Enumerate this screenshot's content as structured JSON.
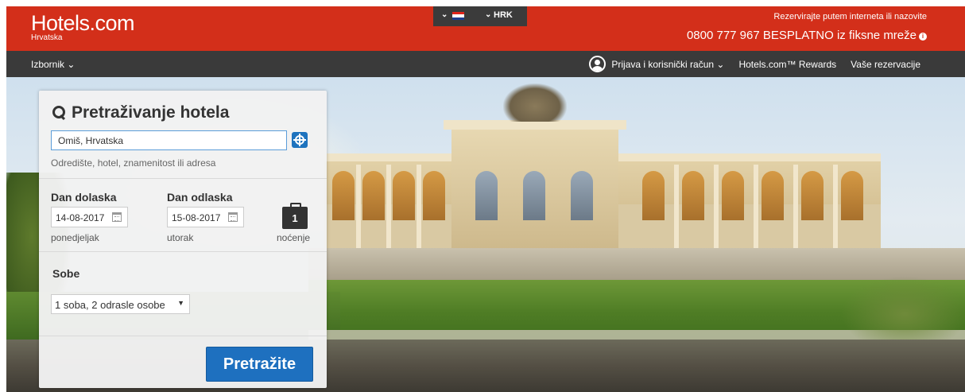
{
  "header": {
    "logo": "Hotels.com",
    "logo_sub": "Hrvatska",
    "currency": "HRK",
    "cta_line1": "Rezervirajte putem interneta ili nazovite",
    "cta_line2": "0800 777 967 BESPLATNO iz fiksne mreže",
    "flag_colors": [
      "#e1251b",
      "#ffffff",
      "#1e3c8c"
    ]
  },
  "nav": {
    "menu": "Izbornik ⌄",
    "account": "Prijava i korisnički račun ⌄",
    "rewards": "Hotels.com™ Rewards",
    "bookings": "Vaše rezervacije"
  },
  "search": {
    "title": "Pretraživanje hotela",
    "destination_value": "Omiš, Hrvatska",
    "destination_hint": "Odredište, hotel, znamenitost ili adresa",
    "checkin_label": "Dan dolaska",
    "checkin_value": "14-08-2017",
    "checkin_day": "ponedjeljak",
    "checkout_label": "Dan odlaska",
    "checkout_value": "15-08-2017",
    "checkout_day": "utorak",
    "nights_count": "1",
    "nights_label": "noćenje",
    "rooms_label": "Sobe",
    "rooms_value": "1 soba, 2 odrasle osobe",
    "submit": "Pretražite"
  },
  "colors": {
    "header_red": "#d32f1a",
    "nav_dark": "#3a3a3a",
    "button_blue": "#1e70bf"
  }
}
